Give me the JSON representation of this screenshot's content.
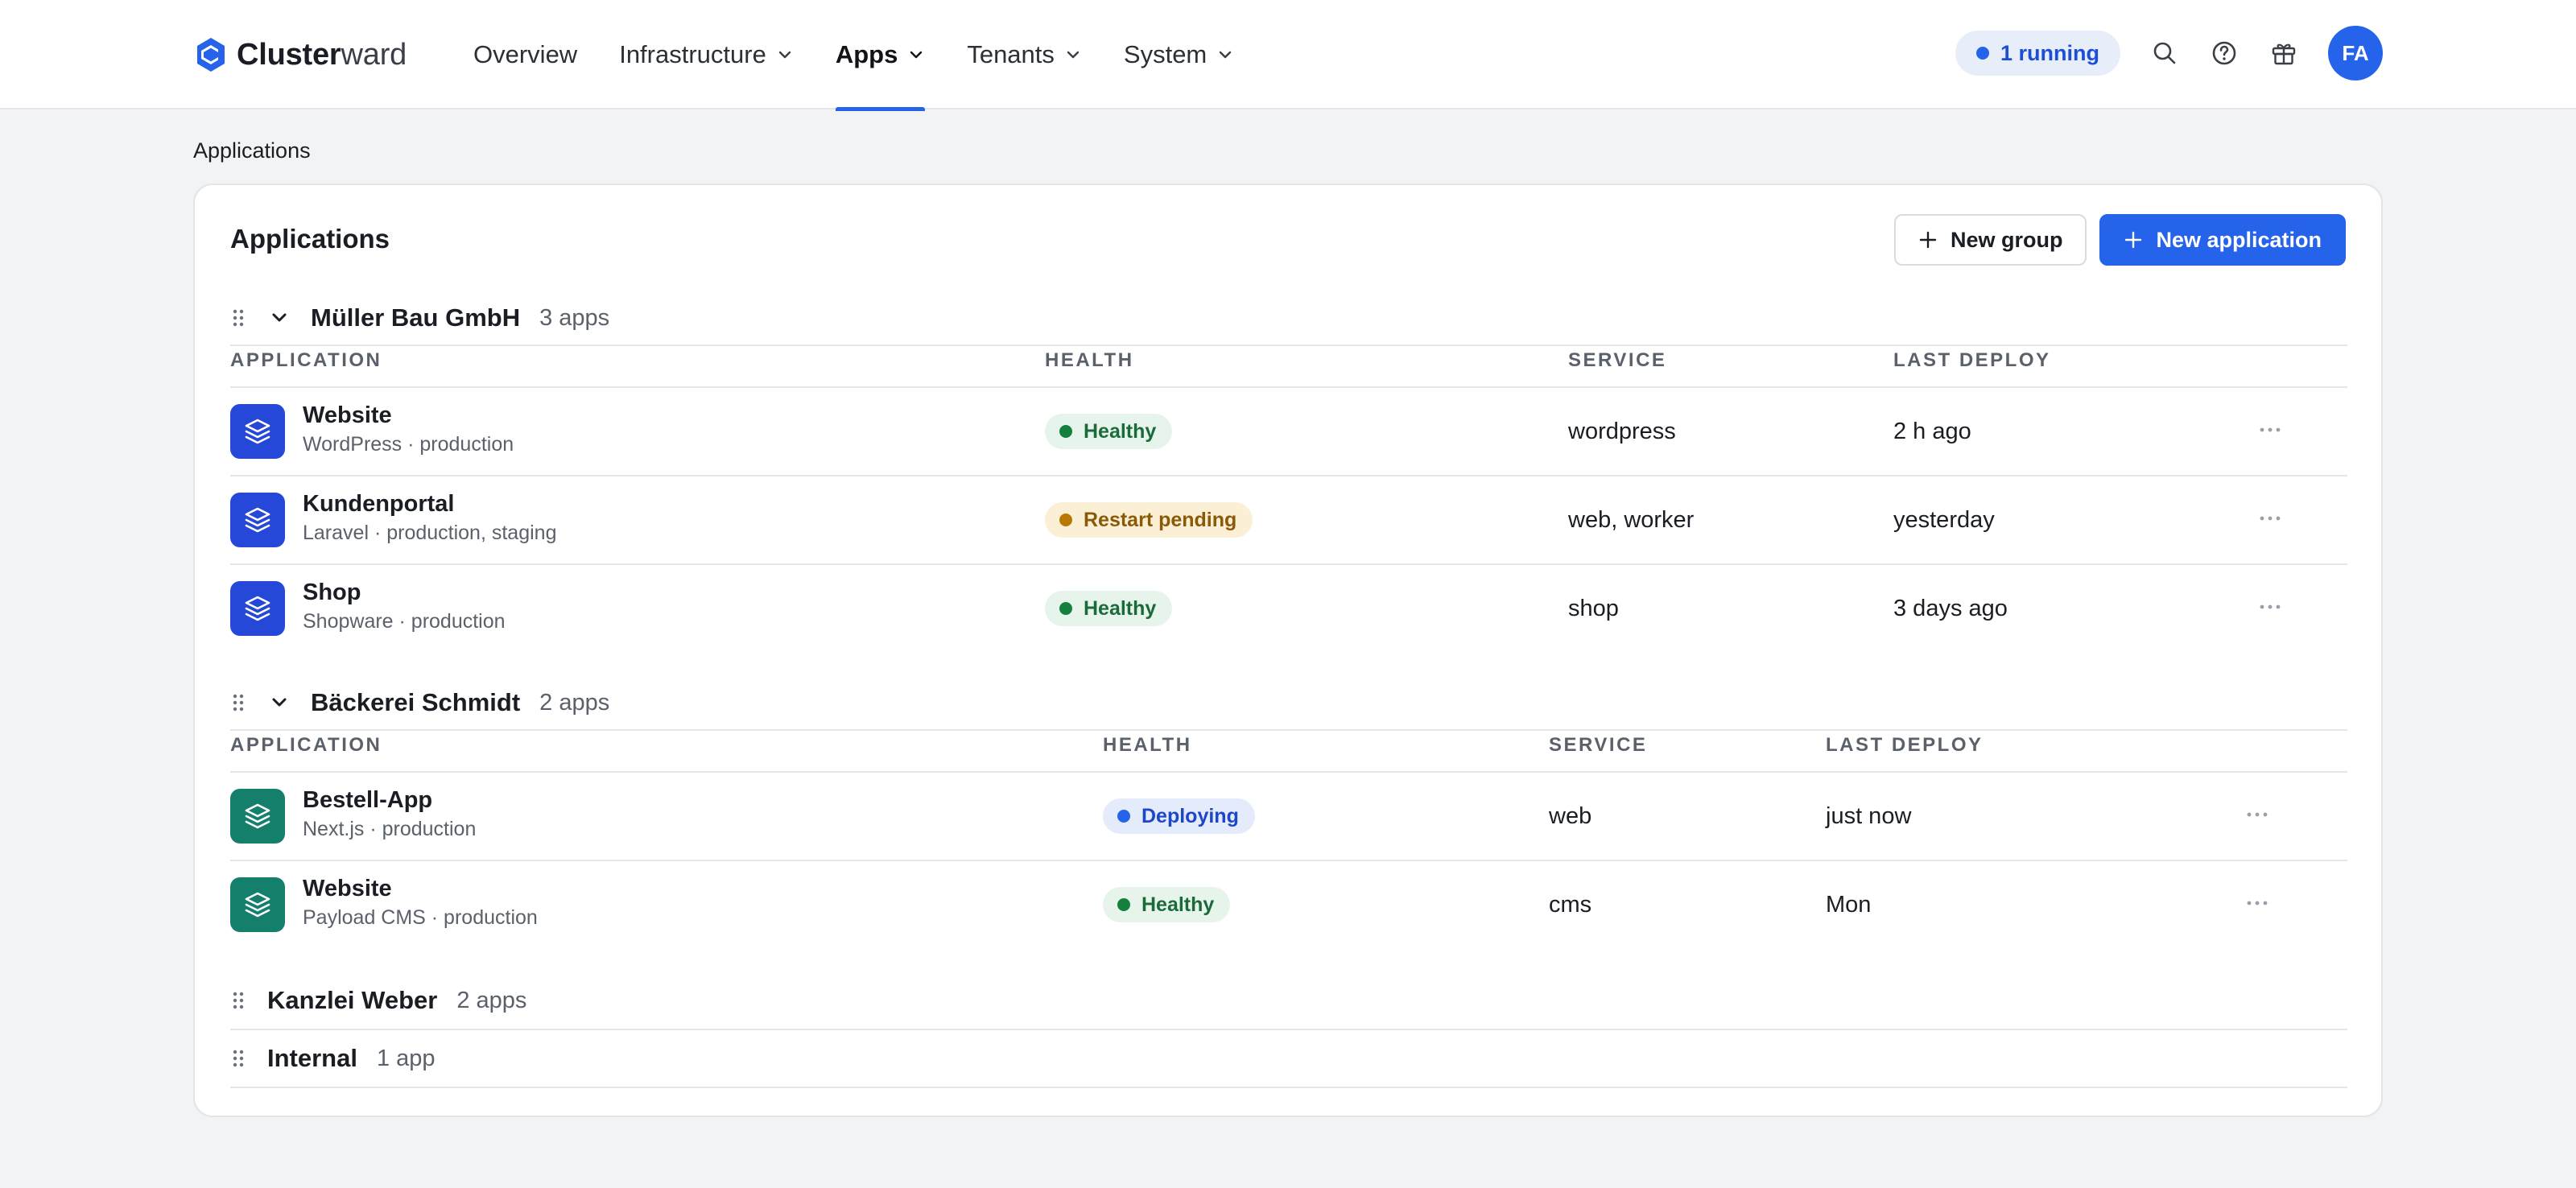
{
  "brand": {
    "name_bold": "Cluster",
    "name_light": "ward"
  },
  "nav": [
    "Overview",
    "Infrastructure",
    "Apps",
    "Tenants",
    "System"
  ],
  "status": {
    "running_label": "1 running"
  },
  "user": {
    "initials": "FA"
  },
  "breadcrumb": "Applications",
  "card": {
    "title": "Applications",
    "new_group": "New group",
    "new_application": "New application"
  },
  "columns": {
    "application": "Application",
    "health": "Health",
    "service": "Service",
    "last_deploy": "Last deploy"
  },
  "groups": [
    {
      "name": "Müller Bau GmbH",
      "count": "3 apps",
      "apps": [
        {
          "name": "Website",
          "meta": "WordPress · production",
          "health": "Healthy",
          "service": "wordpress",
          "deploy": "2 h ago"
        },
        {
          "name": "Kundenportal",
          "meta": "Laravel · production, staging",
          "health": "Restart pending",
          "service": "web, worker",
          "deploy": "yesterday"
        },
        {
          "name": "Shop",
          "meta": "Shopware · production",
          "health": "Healthy",
          "service": "shop",
          "deploy": "3 days ago"
        }
      ]
    },
    {
      "name": "Bäckerei Schmidt",
      "count": "2 apps",
      "apps": [
        {
          "name": "Bestell-App",
          "meta": "Next.js · production",
          "health": "Deploying",
          "service": "web",
          "deploy": "just now"
        },
        {
          "name": "Website",
          "meta": "Payload CMS · production",
          "health": "Healthy",
          "service": "cms",
          "deploy": "Mon"
        }
      ]
    },
    {
      "name": "Kanzlei Weber",
      "count": "2 apps"
    },
    {
      "name": "Internal",
      "count": "1 app"
    }
  ],
  "colors": {
    "accent": "#2563eb",
    "healthy": "#15803d",
    "pending": "#b77904",
    "group1_icon": "#2548d8",
    "group2_icon": "#14806b"
  }
}
